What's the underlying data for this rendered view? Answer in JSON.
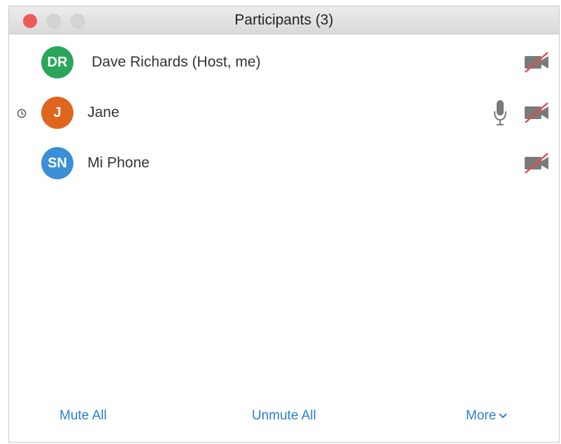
{
  "window": {
    "title": "Participants (3)"
  },
  "participants": [
    {
      "initials": "DR",
      "name": "Dave Richards (Host, me)",
      "avatar_color": "#2aa65a",
      "waiting_icon": "",
      "mic_icon": "",
      "video_icon": "video-off-icon"
    },
    {
      "initials": "J",
      "name": "Jane",
      "avatar_color": "#e0661d",
      "waiting_icon": "clock-icon",
      "mic_icon": "microphone-icon",
      "video_icon": "video-off-icon"
    },
    {
      "initials": "SN",
      "name": "Mi Phone",
      "avatar_color": "#3a8fd6",
      "waiting_icon": "",
      "mic_icon": "",
      "video_icon": "video-off-icon"
    }
  ],
  "footer": {
    "mute_all": "Mute All",
    "unmute_all": "Unmute All",
    "more": "More"
  },
  "colors": {
    "accent": "#2b7fd0",
    "video_off_slash": "#e44a4a",
    "close_button": "#ed5a57"
  }
}
